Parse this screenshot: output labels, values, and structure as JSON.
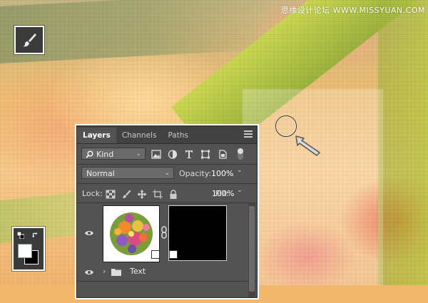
{
  "watermark": "思缘设计论坛 WWW.MISSYUAN.COM",
  "tools": {
    "brush_icon": "brush-icon",
    "color_icon": "color-swatch-icon",
    "foreground_color": "#ffffff",
    "background_color": "#000000"
  },
  "layers_panel": {
    "tabs": [
      {
        "label": "Layers",
        "active": true
      },
      {
        "label": "Channels",
        "active": false
      },
      {
        "label": "Paths",
        "active": false
      }
    ],
    "filter": {
      "kind_label": "Kind",
      "icons": [
        "image-filter-icon",
        "adjustment-filter-icon",
        "type-filter-icon",
        "shape-filter-icon",
        "smart-object-filter-icon"
      ]
    },
    "blend_mode": "Normal",
    "opacity_label": "Opacity:",
    "opacity_value": "100%",
    "lock_label": "Lock:",
    "lock_icons": [
      "lock-transparent-icon",
      "lock-pixels-icon",
      "lock-position-icon",
      "lock-artboard-icon",
      "lock-all-icon"
    ],
    "fill_label": "Fill:",
    "fill_value": "100%",
    "layers": [
      {
        "type": "smart-object-with-mask",
        "visible": true
      },
      {
        "type": "group",
        "name": "Text",
        "visible": true
      }
    ]
  },
  "colors": {
    "panel_bg": "#535353",
    "panel_tabbar": "#424242",
    "accent_green": "#a6bb3e"
  }
}
